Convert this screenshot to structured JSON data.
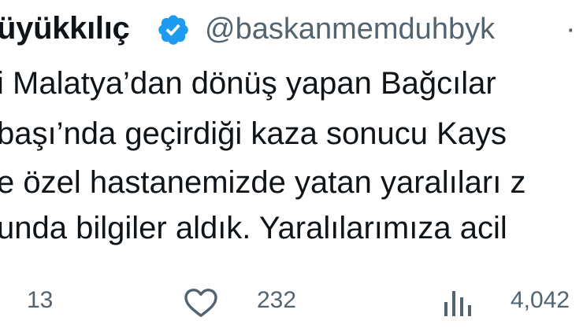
{
  "tweet": {
    "author_name": "üyükkılıç",
    "verified": true,
    "handle": "@baskanmemduhbyk",
    "separator": "·",
    "text_lines": [
      "i Malatya’dan dönüş yapan Bağcılar",
      "başı’nda geçirdiği kaza sonucu Kays",
      "e özel hastanemizde yatan yaralıları z",
      "unda bilgiler aldık. Yaralılarımıza acil"
    ]
  },
  "actions": {
    "replies": "13",
    "likes": "232",
    "views": "4,042"
  },
  "colors": {
    "text": "#0f1419",
    "secondary": "#536471",
    "verified_badge": "#1d9bf0"
  },
  "icons": {
    "verified": "verified-badge-icon",
    "like": "heart-icon",
    "views": "analytics-bars-icon"
  }
}
